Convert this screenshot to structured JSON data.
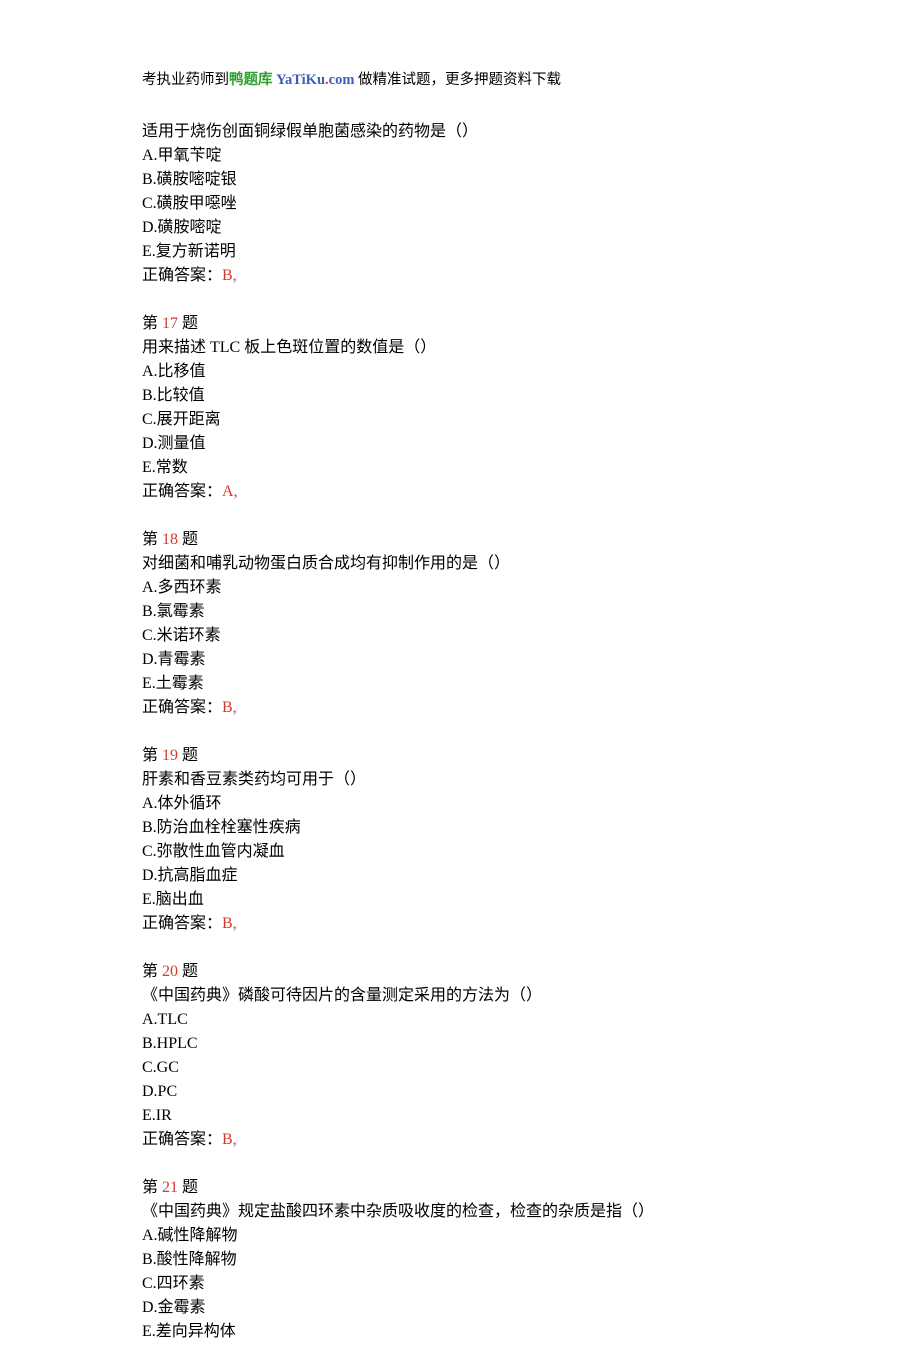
{
  "header": {
    "prefix": "考执业药师到",
    "brand": "鸭题库",
    "domain_main_1": "YaTiKu",
    "domain_dot": ".",
    "domain_main_2": "com",
    "suffix": " 做精准试题，更多押题资料下载"
  },
  "labels": {
    "question_prefix": "第 ",
    "question_suffix": " 题",
    "answer_prefix": "正确答案："
  },
  "q16": {
    "stem": "适用于烧伤创面铜绿假单胞菌感染的药物是（）",
    "optA": "A.甲氧苄啶",
    "optB": "B.磺胺嘧啶银",
    "optC": "C.磺胺甲噁唑",
    "optD": "D.磺胺嘧啶",
    "optE": "E.复方新诺明",
    "answer": "B,"
  },
  "q17": {
    "num": "17",
    "stem": "用来描述 TLC 板上色斑位置的数值是（）",
    "optA": "A.比移值",
    "optB": "B.比较值",
    "optC": "C.展开距离",
    "optD": "D.测量值",
    "optE": "E.常数",
    "answer": "A,"
  },
  "q18": {
    "num": "18",
    "stem": "对细菌和哺乳动物蛋白质合成均有抑制作用的是（）",
    "optA": "A.多西环素",
    "optB": "B.氯霉素",
    "optC": "C.米诺环素",
    "optD": "D.青霉素",
    "optE": "E.土霉素",
    "answer": "B,"
  },
  "q19": {
    "num": "19",
    "stem": "肝素和香豆素类药均可用于（）",
    "optA": "A.体外循环",
    "optB": "B.防治血栓栓塞性疾病",
    "optC": "C.弥散性血管内凝血",
    "optD": "D.抗高脂血症",
    "optE": "E.脑出血",
    "answer": "B,"
  },
  "q20": {
    "num": "20",
    "stem": "《中国药典》磷酸可待因片的含量测定采用的方法为（）",
    "optA": "A.TLC",
    "optB": "B.HPLC",
    "optC": "C.GC",
    "optD": "D.PC",
    "optE": "E.IR",
    "answer": "B,"
  },
  "q21": {
    "num": "21",
    "stem": "《中国药典》规定盐酸四环素中杂质吸收度的检查，检查的杂质是指（）",
    "optA": "A.碱性降解物",
    "optB": "B.酸性降解物",
    "optC": "C.四环素",
    "optD": "D.金霉素",
    "optE": "E.差向异构体"
  }
}
